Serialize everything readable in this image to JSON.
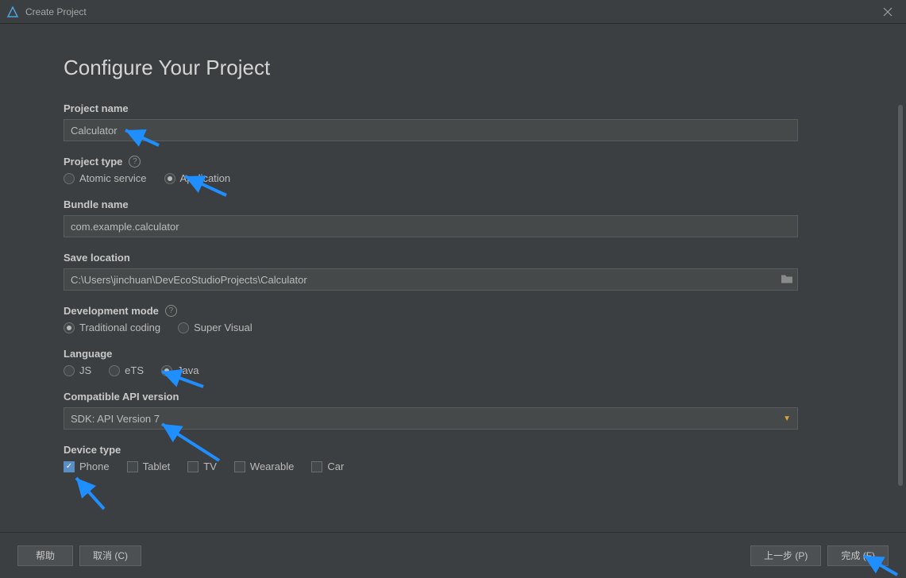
{
  "window": {
    "title": "Create Project"
  },
  "heading": "Configure Your Project",
  "labels": {
    "project_name": "Project name",
    "project_type": "Project type",
    "bundle_name": "Bundle name",
    "save_location": "Save location",
    "dev_mode": "Development mode",
    "language": "Language",
    "api_version": "Compatible API version",
    "device_type": "Device type"
  },
  "fields": {
    "project_name": "Calculator",
    "bundle_name": "com.example.calculator",
    "save_location": "C:\\Users\\jinchuan\\DevEcoStudioProjects\\Calculator",
    "api_version": "SDK: API Version 7"
  },
  "project_type": {
    "options": [
      "Atomic service",
      "Application"
    ],
    "selected": "Application"
  },
  "dev_mode": {
    "options": [
      "Traditional coding",
      "Super Visual"
    ],
    "selected": "Traditional coding"
  },
  "language": {
    "options": [
      "JS",
      "eTS",
      "Java"
    ],
    "selected": "Java"
  },
  "device_type": {
    "options": [
      "Phone",
      "Tablet",
      "TV",
      "Wearable",
      "Car"
    ],
    "checked": [
      "Phone"
    ]
  },
  "buttons": {
    "help": "帮助",
    "cancel": "取消 (C)",
    "prev": "上一步 (P)",
    "finish": "完成 (F)"
  }
}
